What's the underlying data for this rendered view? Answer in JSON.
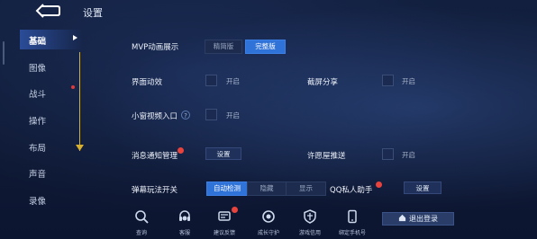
{
  "header": {
    "title": "设置",
    "back_icon": "back-arrow-icon"
  },
  "sidebar": {
    "items": [
      {
        "label": "基础",
        "active": true
      },
      {
        "label": "图像"
      },
      {
        "label": "战斗"
      },
      {
        "label": "操作"
      },
      {
        "label": "布局"
      },
      {
        "label": "声音"
      },
      {
        "label": "录像"
      }
    ]
  },
  "settings": {
    "mvp": {
      "label": "MVP动画展示",
      "options": [
        "精简版",
        "完整版"
      ],
      "selected": "完整版"
    },
    "ui_anim": {
      "label": "界面动效",
      "toggle_label": "开启"
    },
    "screenshot_share": {
      "label": "截屏分享",
      "toggle_label": "开启"
    },
    "mini_video": {
      "label": "小窗视频入口",
      "toggle_label": "开启",
      "help_icon": "question-icon"
    },
    "notifications": {
      "label": "消息通知管理",
      "button": "设置"
    },
    "xu_push": {
      "label": "许愿屋推送",
      "toggle_label": "开启"
    },
    "barrage": {
      "label": "弹幕玩法开关",
      "options": [
        "自动检测",
        "隐藏",
        "显示"
      ],
      "selected": "自动检测"
    },
    "qq_assistant": {
      "label": "QQ私人助手",
      "button": "设置"
    }
  },
  "toolbar": {
    "items": [
      {
        "label": "查询",
        "icon": "search-icon"
      },
      {
        "label": "客服",
        "icon": "customer-service-icon"
      },
      {
        "label": "建议反馈",
        "icon": "feedback-icon",
        "badge": true
      },
      {
        "label": "成长守护",
        "icon": "guardian-icon"
      },
      {
        "label": "游戏信用",
        "icon": "shield-icon"
      },
      {
        "label": "绑定手机号",
        "icon": "phone-icon"
      }
    ],
    "logout": {
      "label": "退出登录",
      "icon": "home-icon"
    }
  },
  "colors": {
    "accent": "#2f72d8",
    "badge": "#e8433c",
    "guide_line": "#d8b030"
  }
}
